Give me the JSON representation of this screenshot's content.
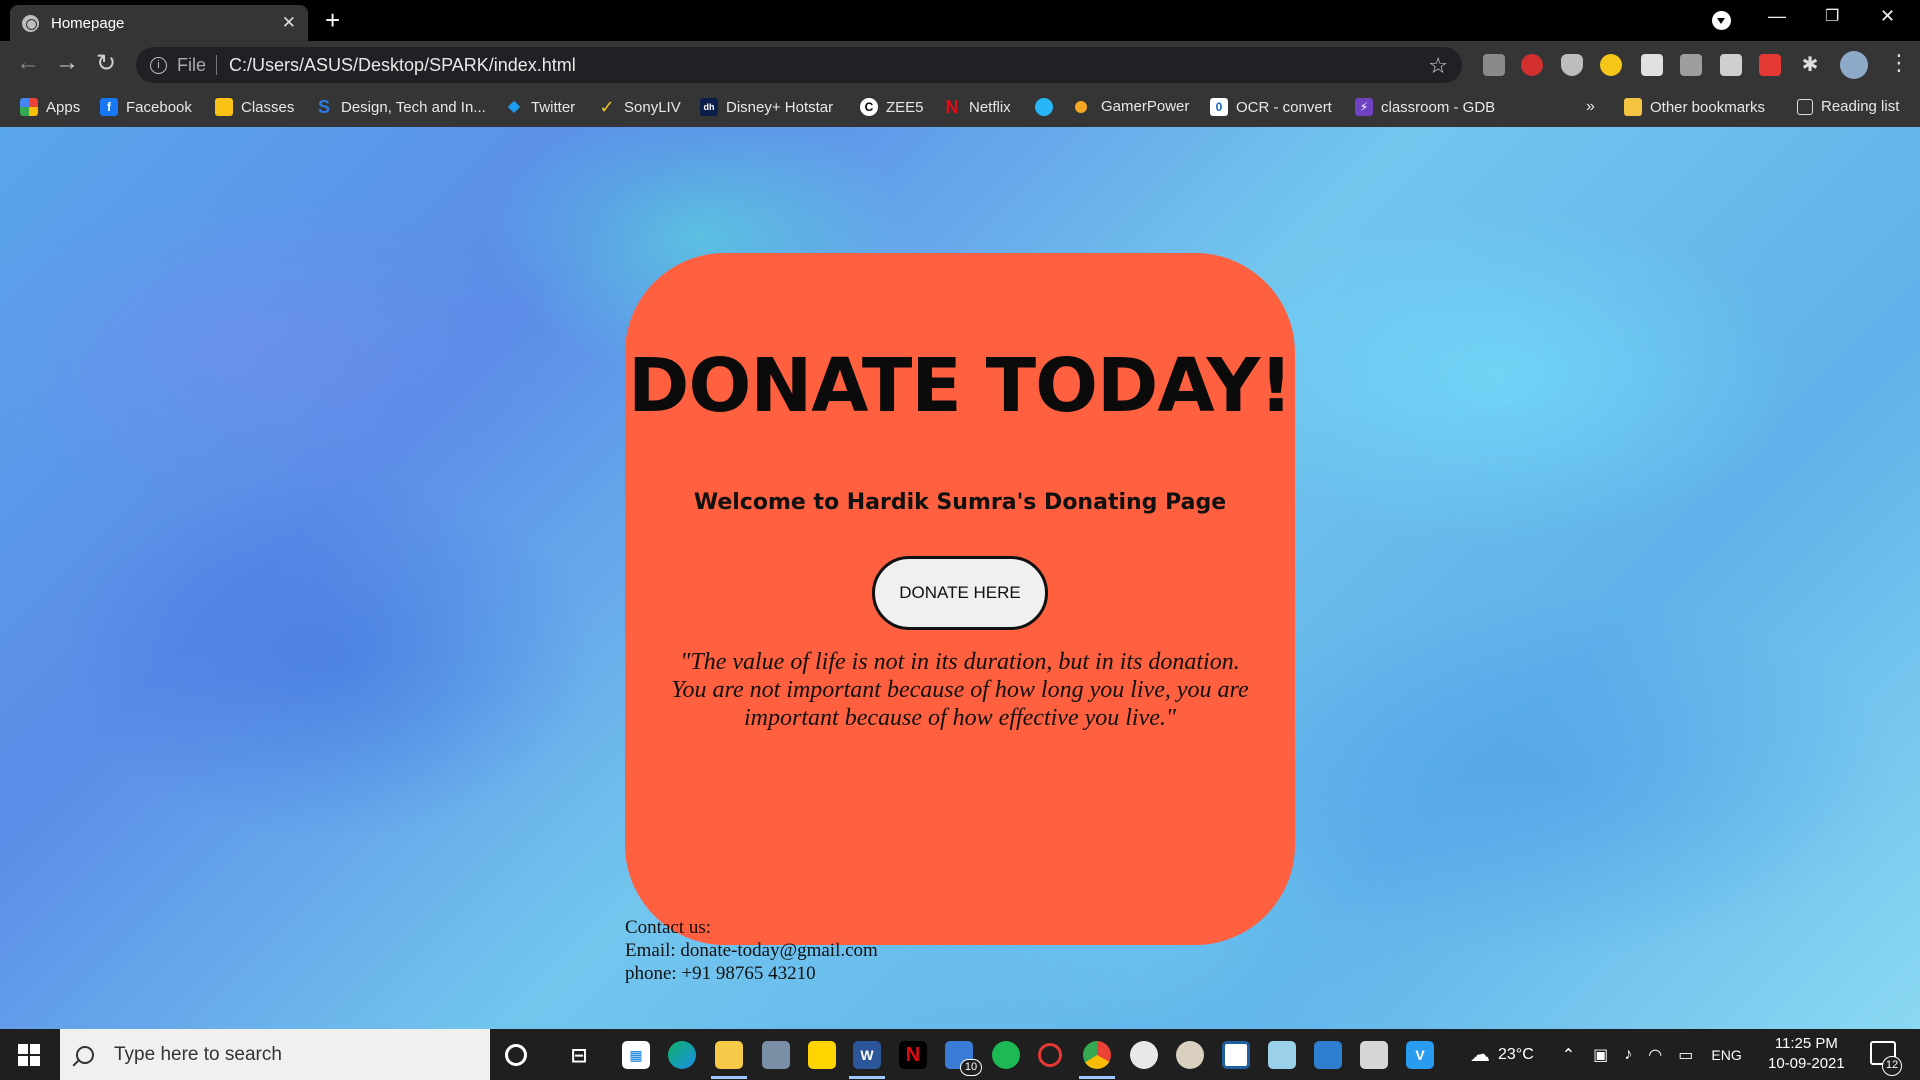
{
  "browser": {
    "tab_title": "Homepage",
    "tab_close": "✕",
    "new_tab": "+",
    "window_min": "—",
    "window_restore": "❐",
    "window_close": "✕"
  },
  "toolbar": {
    "back": "←",
    "forward": "→",
    "reload": "↻",
    "info_glyph": "i",
    "scheme": "File",
    "url": "C:/Users/ASUS/Desktop/SPARK/index.html",
    "star": "☆",
    "menu": "⋮"
  },
  "bookmarks": {
    "items": [
      {
        "label": "Apps",
        "icon": "apps-grid-icon"
      },
      {
        "label": "Facebook",
        "icon": "facebook-icon"
      },
      {
        "label": "Classes",
        "icon": "classroom-icon"
      },
      {
        "label": "Design, Tech and In...",
        "icon": "s-logo-icon"
      },
      {
        "label": "Twitter",
        "icon": "twitter-icon"
      },
      {
        "label": "SonyLIV",
        "icon": "sonyliv-icon"
      },
      {
        "label": "Disney+ Hotstar",
        "icon": "hotstar-icon"
      },
      {
        "label": "ZEE5",
        "icon": "zee5-icon"
      },
      {
        "label": "Netflix",
        "icon": "netflix-icon"
      },
      {
        "label": "",
        "icon": "globe-icon"
      },
      {
        "label": "GamerPower",
        "icon": "gamerpower-icon"
      },
      {
        "label": "OCR - convert",
        "icon": "ocr-icon"
      },
      {
        "label": "classroom - GDB",
        "icon": "gdb-icon"
      }
    ],
    "overflow": "»",
    "other": "Other bookmarks",
    "reading": "Reading list"
  },
  "page": {
    "heading": "DONATE TODAY!",
    "welcome": "Welcome to Hardik Sumra's Donating Page",
    "button": "DONATE HERE",
    "quote": "\"The value of life is not in its duration, but in its donation. You are not important because of how long you live, you are important because of how effective you live.\"",
    "contact_title": "Contact us:",
    "email": "Email: donate-today@gmail.com",
    "phone": "phone: +91 98765 43210",
    "card_color": "#fe6040"
  },
  "taskbar": {
    "search_placeholder": "Type here to search",
    "mail_badge": "10",
    "weather": "23°C",
    "lang": "ENG",
    "time": "11:25 PM",
    "date": "10-09-2021",
    "notif_count": "12"
  }
}
